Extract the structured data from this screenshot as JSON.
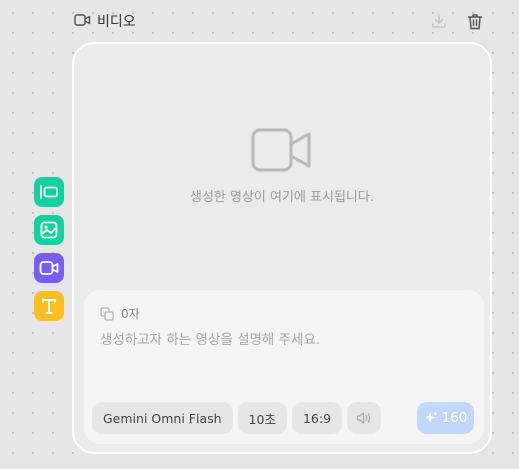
{
  "header": {
    "title": "비디오",
    "icon": "video-icon"
  },
  "actions": {
    "download_icon": "download-icon",
    "delete_icon": "trash-icon"
  },
  "placeholder": {
    "text": "생성한 영상이 여기에 표시됩니다.",
    "icon": "video-camera-icon"
  },
  "composer": {
    "char_count": "0자",
    "prompt_value": "",
    "prompt_placeholder": "생성하고자 하는 영상을 설명해 주세요.",
    "model": "Gemini Omni Flash",
    "duration": "10초",
    "aspect_ratio": "16:9",
    "sound_icon": "speaker-icon",
    "generate_cost": "160",
    "generate_icon": "sparkle-icon"
  },
  "tools": [
    {
      "name": "frame-tool",
      "color": "#12d1a0"
    },
    {
      "name": "image-tool",
      "color": "#12d1a0"
    },
    {
      "name": "video-tool",
      "color": "#7a5cf6"
    },
    {
      "name": "text-tool",
      "color": "#fbbf24"
    }
  ],
  "colors": {
    "accent_generate": "#c1d8fb",
    "tool_green": "#12d1a0",
    "tool_purple": "#7a5cf6",
    "tool_yellow": "#fbbf24"
  }
}
